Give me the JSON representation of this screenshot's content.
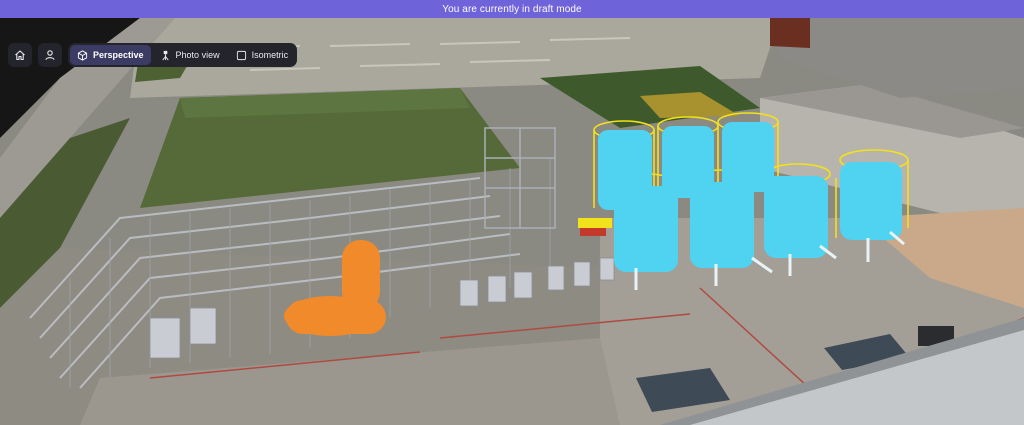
{
  "banner": {
    "text": "You are currently in draft mode"
  },
  "toolbar": {
    "home_icon": "home-icon",
    "user_icon": "user-icon",
    "views": [
      {
        "label": "Perspective",
        "icon": "cube-icon",
        "active": true
      },
      {
        "label": "Photo view",
        "icon": "camera-tripod-icon",
        "active": false
      },
      {
        "label": "Isometric",
        "icon": "square-icon",
        "active": false
      }
    ]
  },
  "colors": {
    "banner": "#6f63d9",
    "toolbar_bg": "#24242c",
    "active_tab": "#3c3b63",
    "tank_cyan": "#4fd3f0",
    "railing_yellow": "#f2e21c",
    "vessel_orange": "#f08a2a"
  }
}
